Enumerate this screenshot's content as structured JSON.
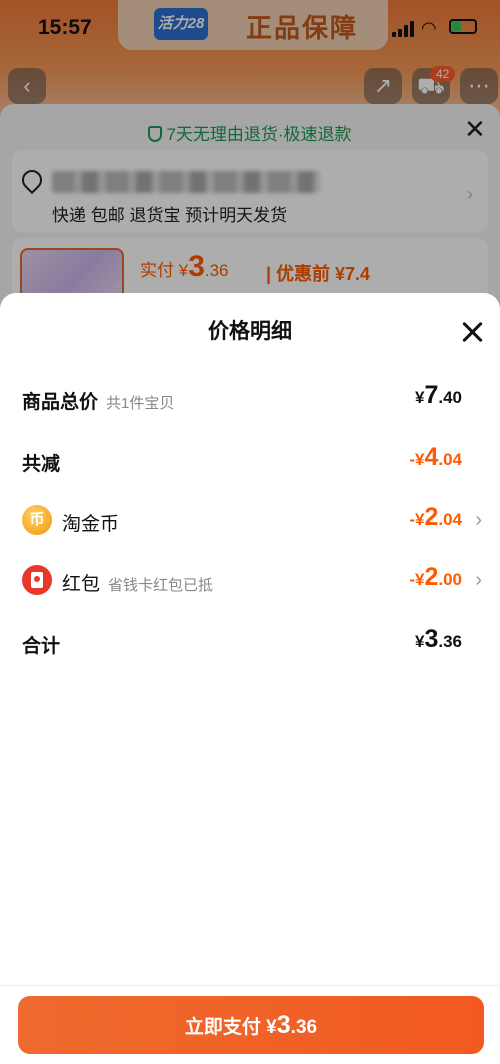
{
  "status_bar": {
    "time": "15:57"
  },
  "brand_banner": {
    "logo_text": "活力28",
    "text": "正品保障"
  },
  "nav": {
    "back_icon": "back-icon",
    "share_icon": "share-icon",
    "cart_icon": "cart-icon",
    "cart_badge": "42",
    "more_icon": "more-icon"
  },
  "background_sheet": {
    "guarantee": "7天无理由退货·极速退款",
    "address_sub": "快递 包邮 退货宝 预计明天发货",
    "paid_label": "实付 ¥",
    "paid_int": "3",
    "paid_dec": ".36",
    "original_label": "| 优惠前 ¥7.4"
  },
  "price_detail": {
    "title": "价格明细",
    "rows": [
      {
        "label": "商品总价",
        "hint": "共1件宝贝",
        "currency": "¥",
        "int": "7",
        "dec": ".40"
      },
      {
        "label": "共减",
        "currency": "-¥",
        "int": "4",
        "dec": ".04"
      },
      {
        "label": "淘金币",
        "icon": "coin-icon",
        "icon_glyph": "币",
        "currency": "-¥",
        "int": "2",
        "dec": ".04"
      },
      {
        "label": "红包",
        "hint": "省钱卡红包已抵",
        "icon": "red-packet-icon",
        "currency": "-¥",
        "int": "2",
        "dec": ".00"
      },
      {
        "label": "合计",
        "currency": "¥",
        "int": "3",
        "dec": ".36"
      }
    ]
  },
  "pay_button": {
    "label": "立即支付 ¥",
    "int": "3",
    "dec": ".36"
  },
  "colors": {
    "accent": "#ff5a00",
    "button": "#f25a22",
    "guarantee_green": "#1c9a52"
  }
}
